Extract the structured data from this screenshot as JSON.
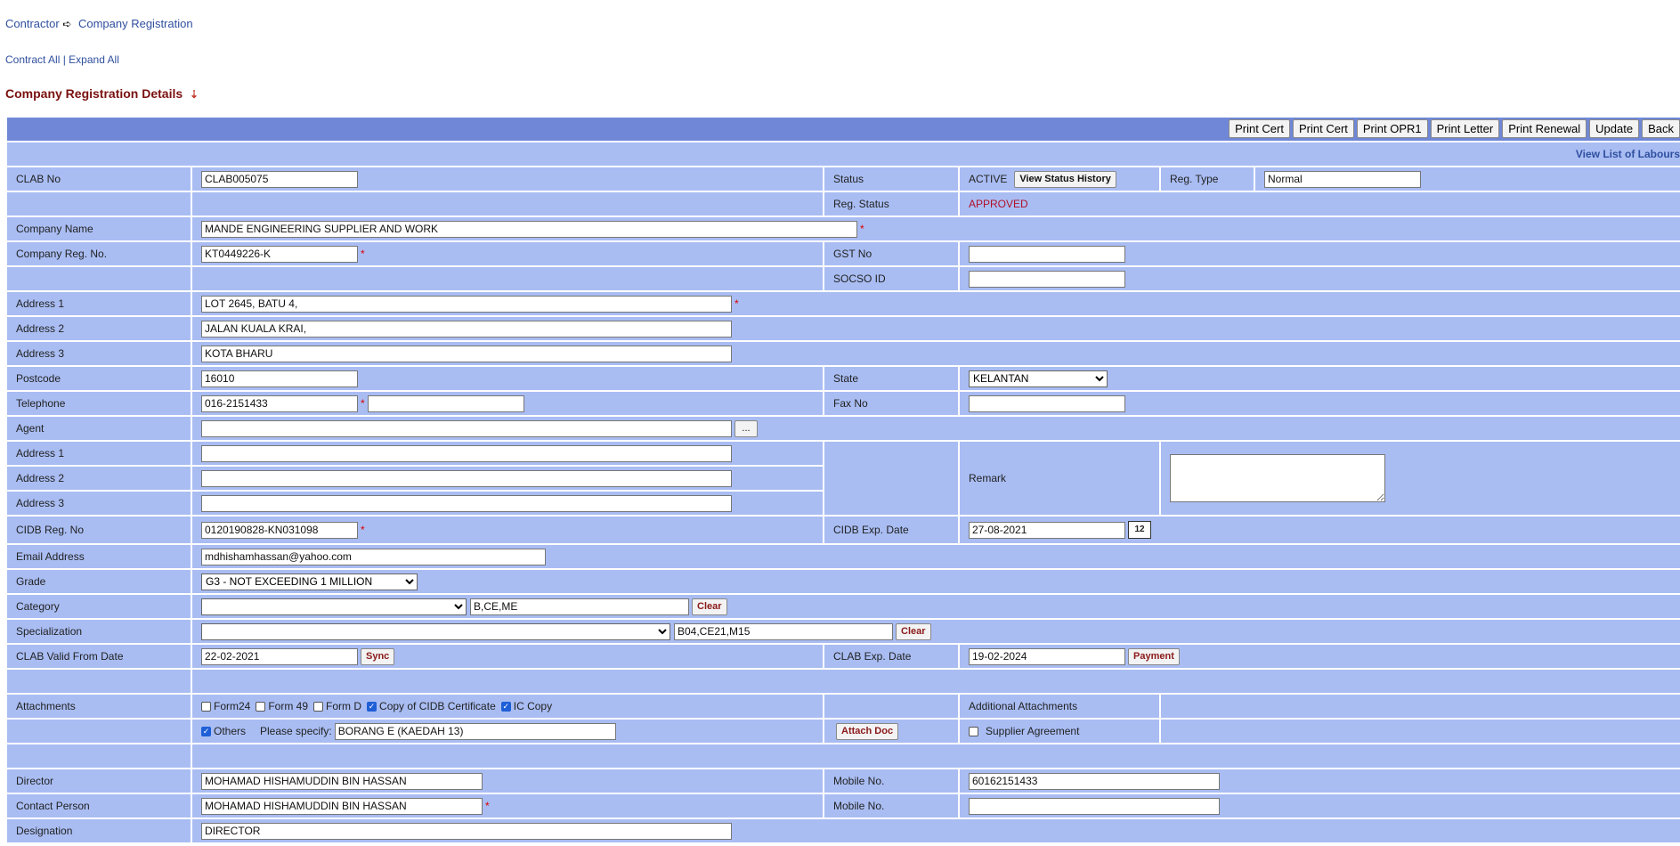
{
  "breadcrumb": {
    "root": "Contractor",
    "current": "Company Registration"
  },
  "expand": {
    "contract": "Contract All",
    "sep": "|",
    "expand": "Expand All"
  },
  "page_title": "Company Registration Details",
  "toolbar": {
    "print_cert_1": "Print Cert",
    "print_cert_2": "Print Cert",
    "print_opr1": "Print OPR1",
    "print_letter": "Print Letter",
    "print_renewal": "Print Renewal",
    "update": "Update",
    "back": "Back"
  },
  "view_labours_link": "View List of Labours",
  "form": {
    "clab_no_label": "CLAB No",
    "clab_no": "CLAB005075",
    "status_label": "Status",
    "status": "ACTIVE",
    "view_status_history": "View Status History",
    "reg_type_label": "Reg. Type",
    "reg_type": "Normal",
    "reg_status_label": "Reg. Status",
    "reg_status": "APPROVED",
    "company_name_label": "Company Name",
    "company_name": "MANDE ENGINEERING SUPPLIER AND WORK",
    "company_reg_label": "Company Reg. No.",
    "company_reg": "KT0449226-K",
    "gst_label": "GST No",
    "gst": "",
    "socso_label": "SOCSO ID",
    "socso": "",
    "address1_label": "Address 1",
    "address1": "LOT 2645, BATU 4,",
    "address2_label": "Address 2",
    "address2": "JALAN KUALA KRAI,",
    "address3_label": "Address 3",
    "address3": "KOTA BHARU",
    "postcode_label": "Postcode",
    "postcode": "16010",
    "state_label": "State",
    "state": "KELANTAN",
    "telephone_label": "Telephone",
    "telephone": "016-2151433",
    "telephone2": "",
    "fax_label": "Fax No",
    "fax": "",
    "agent_label": "Agent",
    "agent": "",
    "agent_lookup": "...",
    "agent_address1_label": "Address 1",
    "agent_address1": "",
    "agent_address2_label": "Address 2",
    "agent_address2": "",
    "agent_address3_label": "Address 3",
    "agent_address3": "",
    "remark_label": "Remark",
    "remark": "",
    "cidb_reg_label": "CIDB Reg. No",
    "cidb_reg": "0120190828-KN031098",
    "cidb_exp_label": "CIDB Exp. Date",
    "cidb_exp": "27-08-2021",
    "calendar_glyph": "12",
    "email_label": "Email Address",
    "email": "mdhishamhassan@yahoo.com",
    "grade_label": "Grade",
    "grade": "G3 - NOT EXCEEDING 1 MILLION",
    "category_label": "Category",
    "category_select": "",
    "category_value": "B,CE,ME",
    "category_clear": "Clear",
    "specialization_label": "Specialization",
    "specialization_select": "",
    "specialization_value": "B04,CE21,M15",
    "specialization_clear": "Clear",
    "clab_valid_label": "CLAB Valid From Date",
    "clab_valid": "22-02-2021",
    "sync": "Sync",
    "clab_exp_label": "CLAB Exp. Date",
    "clab_exp": "19-02-2024",
    "payment": "Payment",
    "attachments_label": "Attachments",
    "att_form24": "Form24",
    "att_form49": "Form 49",
    "att_formd": "Form D",
    "att_cidb_cert": "Copy of CIDB Certificate",
    "att_ic": "IC Copy",
    "additional_attachments_label": "Additional Attachments",
    "att_others": "Others",
    "please_specify_label": "Please specify:",
    "please_specify": "BORANG E (KAEDAH 13)",
    "attach_doc": "Attach Doc",
    "supplier_agreement": "Supplier Agreement",
    "director_label": "Director",
    "director": "MOHAMAD HISHAMUDDIN BIN HASSAN",
    "director_mobile_label": "Mobile No.",
    "director_mobile": "60162151433",
    "contact_label": "Contact Person",
    "contact": "MOHAMAD HISHAMUDDIN BIN HASSAN",
    "contact_mobile_label": "Mobile No.",
    "contact_mobile": "",
    "designation_label": "Designation",
    "designation": "DIRECTOR",
    "required_mark": "*"
  },
  "colors": {
    "toolbar_bg": "#6f87d6",
    "cell_bg": "#a9bdf3",
    "link": "#2f4f9f",
    "title": "#7a1010",
    "approved": "#b0102a"
  }
}
